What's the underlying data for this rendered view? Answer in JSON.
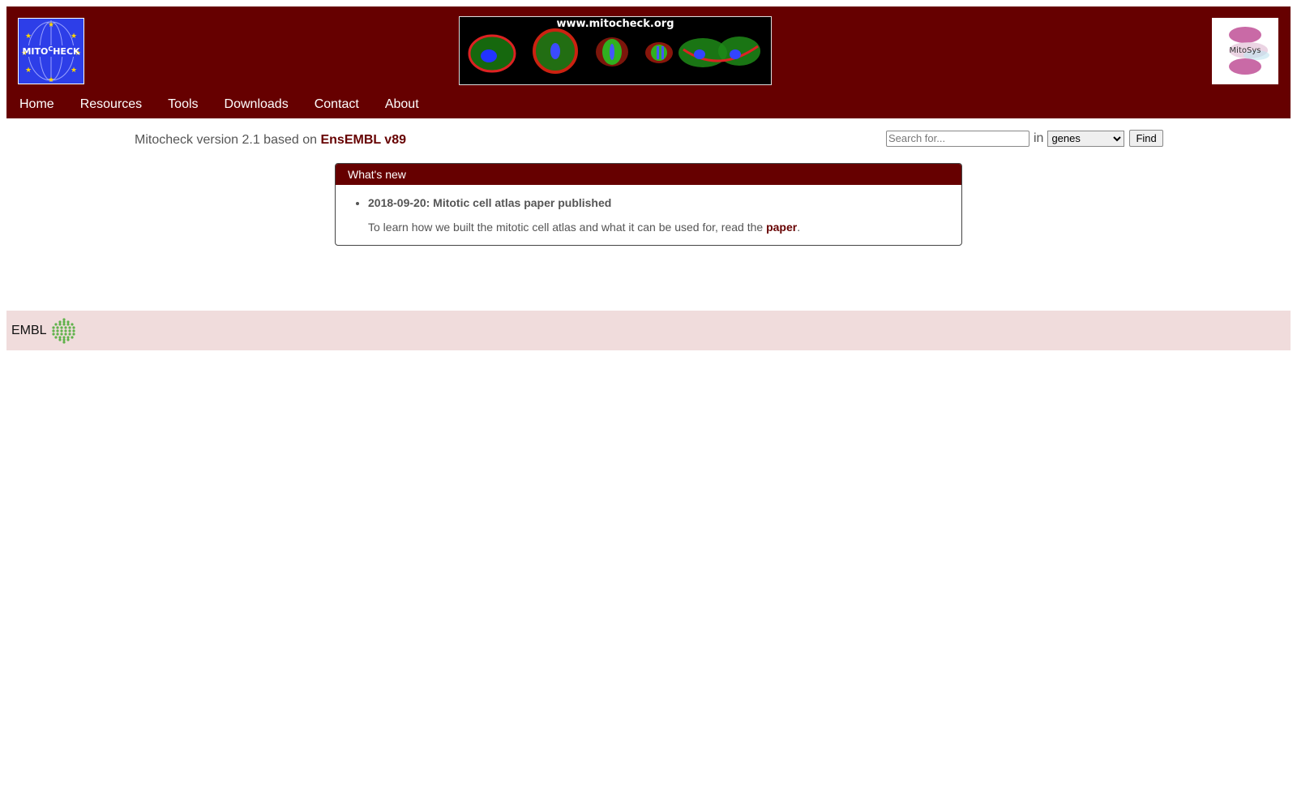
{
  "header": {
    "banner_url": "www.mitocheck.org",
    "logo_left_alt": "MITOCHECK",
    "logo_right_text": "MitoSys",
    "nav": [
      {
        "label": "Home"
      },
      {
        "label": "Resources"
      },
      {
        "label": "Tools"
      },
      {
        "label": "Downloads"
      },
      {
        "label": "Contact"
      },
      {
        "label": "About"
      }
    ],
    "icons": {
      "left_logo": "mitocheck-logo-icon",
      "banner": "cell-images-banner",
      "right_logo": "mitosys-logo-icon"
    }
  },
  "version": {
    "prefix": "Mitocheck version 2.1 based on",
    "link": "EnsEMBL v89"
  },
  "search": {
    "placeholder": "Search for...",
    "in_label": "in",
    "selected": "genes",
    "button": "Find"
  },
  "news": {
    "heading": "What's new",
    "items": [
      {
        "title": "2018-09-20: Mitotic cell atlas paper published",
        "body_prefix": "To learn how we built the mitotic cell atlas and what it can be used for, read the",
        "link": "paper",
        "body_suffix": "."
      }
    ]
  },
  "footer": {
    "label": "EMBL",
    "icon": "embl-logo-icon"
  },
  "colors": {
    "brand": "#660000",
    "footer_bg": "#f0dcdc"
  }
}
